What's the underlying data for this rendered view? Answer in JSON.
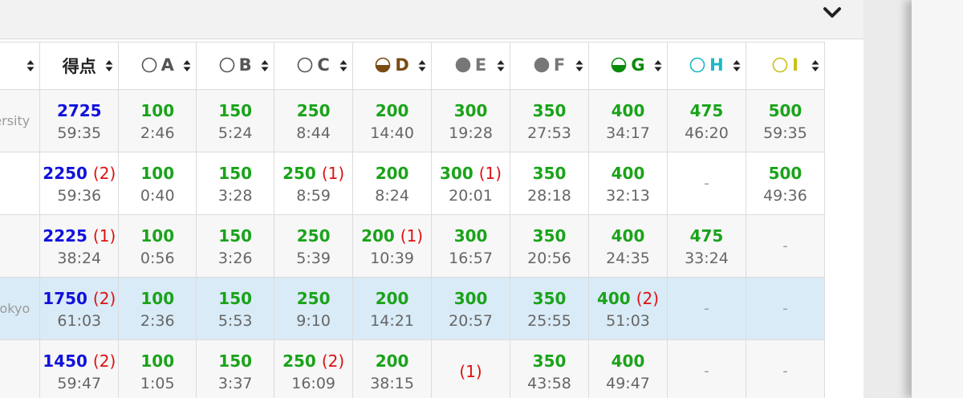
{
  "header": {
    "score_label": "得点",
    "chevron_icon": "chevron-down-icon"
  },
  "problems": [
    {
      "label": "A",
      "icon": "empty-circle",
      "color": "#555555"
    },
    {
      "label": "B",
      "icon": "empty-circle",
      "color": "#555555"
    },
    {
      "label": "C",
      "icon": "empty-circle",
      "color": "#555555"
    },
    {
      "label": "D",
      "icon": "half-filled-circle",
      "color": "#7a4a12"
    },
    {
      "label": "E",
      "icon": "filled-circle",
      "color": "#777777"
    },
    {
      "label": "F",
      "icon": "filled-circle",
      "color": "#777777"
    },
    {
      "label": "G",
      "icon": "half-filled-circle",
      "color": "#0a8a0a"
    },
    {
      "label": "H",
      "icon": "empty-circle",
      "color": "#1ab8c8"
    },
    {
      "label": "I",
      "icon": "empty-circle",
      "color": "#c8c21a"
    }
  ],
  "rows": [
    {
      "team": "ersity",
      "score": "2725",
      "score_pen": "",
      "score_time": "59:35",
      "cells": [
        {
          "pts": "100",
          "pen": "",
          "time": "2:46"
        },
        {
          "pts": "150",
          "pen": "",
          "time": "5:24"
        },
        {
          "pts": "250",
          "pen": "",
          "time": "8:44"
        },
        {
          "pts": "200",
          "pen": "",
          "time": "14:40"
        },
        {
          "pts": "300",
          "pen": "",
          "time": "19:28"
        },
        {
          "pts": "350",
          "pen": "",
          "time": "27:53"
        },
        {
          "pts": "400",
          "pen": "",
          "time": "34:17"
        },
        {
          "pts": "475",
          "pen": "",
          "time": "46:20"
        },
        {
          "pts": "500",
          "pen": "",
          "time": "59:35"
        }
      ]
    },
    {
      "team": "",
      "score": "2250",
      "score_pen": "(2)",
      "score_time": "59:36",
      "cells": [
        {
          "pts": "100",
          "pen": "",
          "time": "0:40"
        },
        {
          "pts": "150",
          "pen": "",
          "time": "3:28"
        },
        {
          "pts": "250",
          "pen": "(1)",
          "time": "8:59"
        },
        {
          "pts": "200",
          "pen": "",
          "time": "8:24"
        },
        {
          "pts": "300",
          "pen": "(1)",
          "time": "20:01"
        },
        {
          "pts": "350",
          "pen": "",
          "time": "28:18"
        },
        {
          "pts": "400",
          "pen": "",
          "time": "32:13"
        },
        {
          "dash": "-"
        },
        {
          "pts": "500",
          "pen": "",
          "time": "49:36"
        }
      ]
    },
    {
      "team": "",
      "score": "2225",
      "score_pen": "(1)",
      "score_time": "38:24",
      "cells": [
        {
          "pts": "100",
          "pen": "",
          "time": "0:56"
        },
        {
          "pts": "150",
          "pen": "",
          "time": "3:26"
        },
        {
          "pts": "250",
          "pen": "",
          "time": "5:39"
        },
        {
          "pts": "200",
          "pen": "(1)",
          "time": "10:39"
        },
        {
          "pts": "300",
          "pen": "",
          "time": "16:57"
        },
        {
          "pts": "350",
          "pen": "",
          "time": "20:56"
        },
        {
          "pts": "400",
          "pen": "",
          "time": "24:35"
        },
        {
          "pts": "475",
          "pen": "",
          "time": "33:24"
        },
        {
          "dash": "-"
        }
      ]
    },
    {
      "team": "okyo",
      "score": "1750",
      "score_pen": "(2)",
      "score_time": "61:03",
      "cells": [
        {
          "pts": "100",
          "pen": "",
          "time": "2:36"
        },
        {
          "pts": "150",
          "pen": "",
          "time": "5:53"
        },
        {
          "pts": "250",
          "pen": "",
          "time": "9:10"
        },
        {
          "pts": "200",
          "pen": "",
          "time": "14:21"
        },
        {
          "pts": "300",
          "pen": "",
          "time": "20:57"
        },
        {
          "pts": "350",
          "pen": "",
          "time": "25:55"
        },
        {
          "pts": "400",
          "pen": "(2)",
          "time": "51:03"
        },
        {
          "dash": "-"
        },
        {
          "dash": "-"
        }
      ]
    },
    {
      "team": "",
      "score": "1450",
      "score_pen": "(2)",
      "score_time": "59:47",
      "cells": [
        {
          "pts": "100",
          "pen": "",
          "time": "1:05"
        },
        {
          "pts": "150",
          "pen": "",
          "time": "3:37"
        },
        {
          "pts": "250",
          "pen": "(2)",
          "time": "16:09"
        },
        {
          "pts": "200",
          "pen": "",
          "time": "38:15"
        },
        {
          "pts": "",
          "pen": "(1)",
          "time": ""
        },
        {
          "pts": "350",
          "pen": "",
          "time": "43:58"
        },
        {
          "pts": "400",
          "pen": "",
          "time": "49:47"
        },
        {
          "dash": "-"
        },
        {
          "dash": "-"
        }
      ]
    }
  ]
}
